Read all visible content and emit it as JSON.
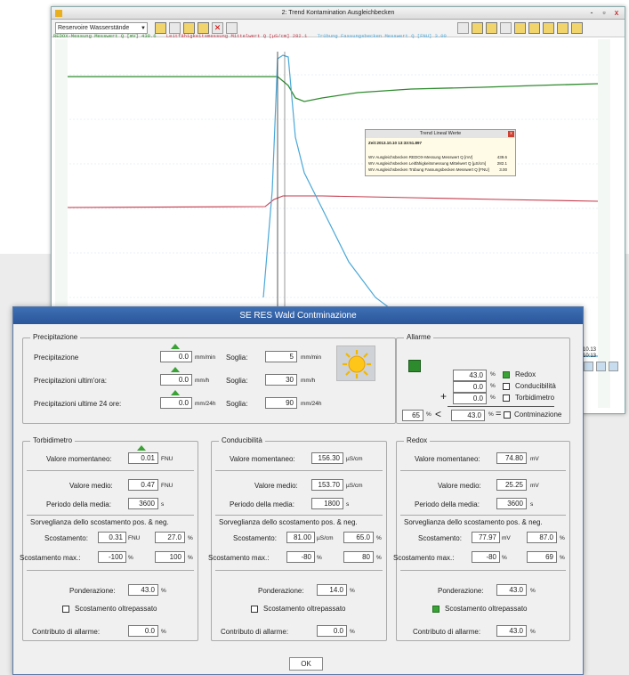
{
  "trend_window": {
    "title": "2: Trend Kontamination Ausgleichbecken",
    "window_buttons": [
      "-",
      "▫",
      "x"
    ],
    "selector_value": "Reservoire Wasserstände",
    "legend": [
      {
        "text": "REDOX-Messung Messwert Q [mV] 439.6",
        "color": "#2e8b2e"
      },
      {
        "text": "Leitfähigkeitsmessung Mittelwert Q [µS/cm] 282.1",
        "color": "#c4384a"
      },
      {
        "text": "Trübung Fassungsbecken Messwert Q [FNU] 3.00",
        "color": "#4aa8d8"
      }
    ],
    "popup": {
      "title": "Trend Lineal Werte",
      "time": "Zeit:2013.10.10 13:33:51.897",
      "rows": [
        {
          "label": "WV Ausgleichsbecken REDOX-Messung Messwert Q [mV]",
          "value": "439.6"
        },
        {
          "label": "WV Ausgleichsbecken Leitfähigkeitsmessung Mittelwert Q [µS/cm]",
          "value": "282.1"
        },
        {
          "label": "WV Ausgleichsbecken Trübung Fassungsbecken Messwert Q [FNU]",
          "value": "3.00"
        }
      ]
    },
    "corner_time": "10.13",
    "corner_time2": "10:13"
  },
  "dialog": {
    "title": "SE RES Wald Contminazione",
    "precip": {
      "group": "Precipitazione",
      "rows": [
        {
          "label": "Precipitazione",
          "value": "0.0",
          "unit": "mm/min",
          "soglia_label": "Soglia:",
          "soglia": "5",
          "soglia_unit": "mm/min"
        },
        {
          "label": "Precipitazioni ultim'ora:",
          "value": "0.0",
          "unit": "mm/h",
          "soglia_label": "Soglia:",
          "soglia": "30",
          "soglia_unit": "mm/h"
        },
        {
          "label": "Precipitazioni ultime 24 ore:",
          "value": "0.0",
          "unit": "mm/24h",
          "soglia_label": "Soglia:",
          "soglia": "90",
          "soglia_unit": "mm/24h"
        }
      ]
    },
    "alarm": {
      "group": "Allarme",
      "rows": [
        {
          "value": "43.0",
          "unit": "%",
          "label": "Redox",
          "checked": true
        },
        {
          "value": "0.0",
          "unit": "%",
          "label": "Conducibilità",
          "checked": false
        },
        {
          "value": "0.0",
          "unit": "%",
          "label": "Torbidimetro",
          "checked": false
        }
      ],
      "plus": "+",
      "threshold": "65",
      "threshold_unit": "%",
      "lt": "<",
      "total": "43.0",
      "total_unit": "%",
      "eq": "=",
      "result_label": "Contminazione"
    },
    "sensors": [
      {
        "group": "Torbidimetro",
        "mom_label": "Valore momentaneo:",
        "mom": "0.01",
        "mom_unit": "FNU",
        "avg_label": "Valore medio:",
        "avg": "0.47",
        "avg_unit": "FNU",
        "period_label": "Periodo della media:",
        "period": "3600",
        "period_unit": "s",
        "surv": "Sorveglianza dello scostamento pos. & neg.",
        "dev_label": "Scostamento:",
        "dev": "0.31",
        "dev_unit": "FNU",
        "dev_pct": "27.0",
        "pct": "%",
        "max_label": "Scostamento max.:",
        "max_neg": "-100",
        "max_pos": "100",
        "weight_label": "Ponderazione:",
        "weight": "43.0",
        "exceeded": "Scostamento oltrepassato",
        "exceeded_on": false,
        "contrib_label": "Contributo di allarme:",
        "contrib": "0.0"
      },
      {
        "group": "Conducibilità",
        "mom_label": "Valore momentaneo:",
        "mom": "156.30",
        "mom_unit": "µS/cm",
        "avg_label": "Valore medio:",
        "avg": "153.70",
        "avg_unit": "µS/cm",
        "period_label": "Periodo della media:",
        "period": "1800",
        "period_unit": "s",
        "surv": "Sorveglianza dello scostamento pos. & neg.",
        "dev_label": "Scostamento:",
        "dev": "81.00",
        "dev_unit": "µS/cm",
        "dev_pct": "65.0",
        "pct": "%",
        "max_label": "Scostamento max.:",
        "max_neg": "-80",
        "max_pos": "80",
        "weight_label": "Ponderazione:",
        "weight": "14.0",
        "exceeded": "Scostamento oltrepassato",
        "exceeded_on": false,
        "contrib_label": "Contributo di allarme:",
        "contrib": "0.0"
      },
      {
        "group": "Redox",
        "mom_label": "Valore momentaneo:",
        "mom": "74.80",
        "mom_unit": "mV",
        "avg_label": "Valore medio:",
        "avg": "25.25",
        "avg_unit": "mV",
        "period_label": "Periodo della media:",
        "period": "3600",
        "period_unit": "s",
        "surv": "Sorveglianza dello scostamento pos. & neg.",
        "dev_label": "Scostamento:",
        "dev": "77.97",
        "dev_unit": "mV",
        "dev_pct": "87.0",
        "pct": "%",
        "max_label": "Scostamento max.:",
        "max_neg": "-80",
        "max_pos": "69",
        "weight_label": "Ponderazione:",
        "weight": "43.0",
        "exceeded": "Scostamento oltrepassato",
        "exceeded_on": true,
        "contrib_label": "Contributo di allarme:",
        "contrib": "43.0"
      }
    ],
    "ok_label": "OK"
  }
}
